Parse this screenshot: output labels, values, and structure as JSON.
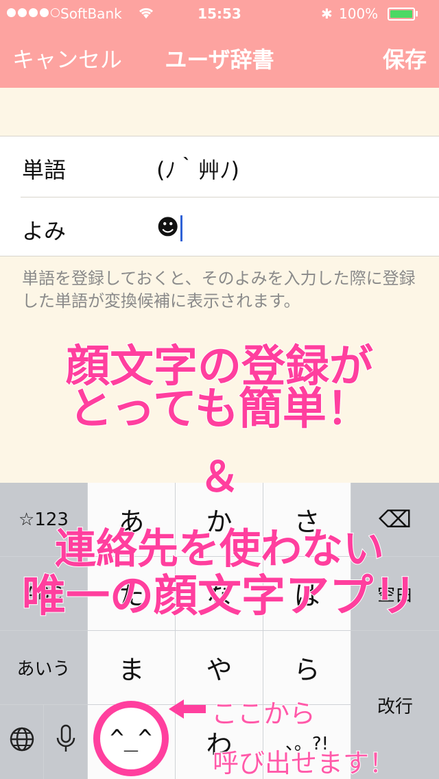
{
  "status_bar": {
    "carrier": "SoftBank",
    "time": "15:53",
    "battery_percent": "100%",
    "battery_level": 1.0,
    "signal_bars_filled": 4,
    "signal_bars_total": 5,
    "icons": [
      "wifi-icon",
      "bluetooth-icon",
      "battery-icon"
    ]
  },
  "nav": {
    "cancel_label": "キャンセル",
    "title": "ユーザ辞書",
    "save_label": "保存"
  },
  "form": {
    "word_label": "単語",
    "word_value": "(ﾉ｀艸ﾉ)",
    "reading_label": "よみ",
    "reading_value": "☻"
  },
  "help_text": "単語を登録しておくと、そのよみを入力した際に登録した単語が変換候補に表示されます。",
  "keyboard": {
    "row1": [
      "☆123",
      "あ",
      "か",
      "さ",
      "⌫"
    ],
    "row2": [
      "ABC",
      "た",
      "な",
      "は",
      "空白"
    ],
    "row3": [
      "あいう",
      "ま",
      "や",
      "ら"
    ],
    "row4": [
      "🌐",
      "🎤",
      "^_^",
      "わ",
      "、。?!",
      "改行"
    ]
  },
  "promo": {
    "headline1a": "顔文字の登録が",
    "headline1b": "とっても簡単！",
    "ampersand": "＆",
    "headline2a": "連絡先を使わない",
    "headline2b": "唯一の顔文字アプリ",
    "callout_a": "ここから",
    "callout_b": "呼び出せます！"
  },
  "colors": {
    "nav_bg": "#fda3a0",
    "page_bg": "#fdf6e6",
    "promo_pink": "#ff3f9e",
    "cursor": "#2f62d6"
  }
}
